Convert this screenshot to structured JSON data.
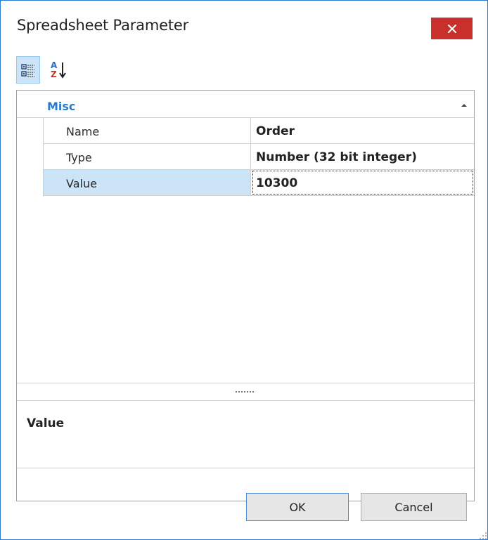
{
  "window": {
    "title": "Spreadsheet Parameter",
    "close_icon": "close-icon",
    "border_color": "#2b7bd4",
    "close_color": "#c9302c"
  },
  "toolbar": {
    "categorized_icon": "categorized-view-icon",
    "alphabetical_icon": "sort-az-icon"
  },
  "property_grid": {
    "category": "Misc",
    "collapse_icon": "collapse-arrow-icon",
    "accent": "#2b79c9",
    "selection": "#cce4f7",
    "rows": [
      {
        "name": "Name",
        "value": "Order"
      },
      {
        "name": "Type",
        "value": "Number (32 bit integer)"
      },
      {
        "name": "Value",
        "value": "10300"
      }
    ]
  },
  "description": {
    "title": "Value"
  },
  "buttons": {
    "ok": "OK",
    "cancel": "Cancel"
  }
}
